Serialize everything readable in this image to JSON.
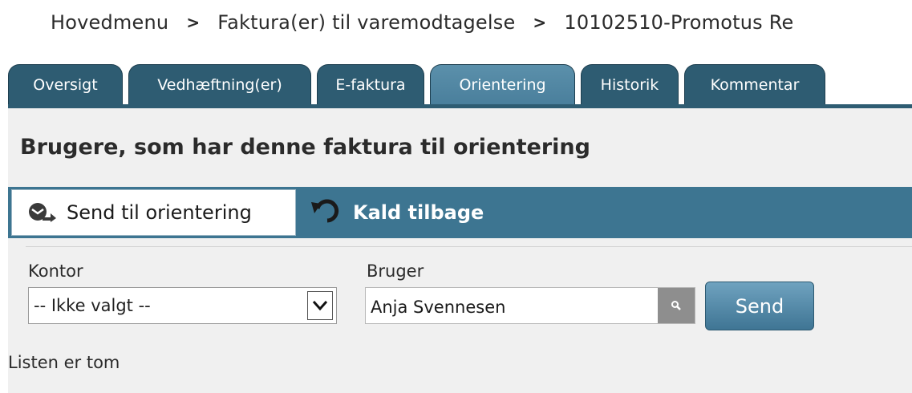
{
  "breadcrumb": {
    "items": [
      "Hovedmenu",
      "Faktura(er) til varemodtagelse",
      "10102510-Promotus Re"
    ],
    "separator": ">"
  },
  "tabs": [
    {
      "label": "Oversigt",
      "active": false
    },
    {
      "label": "Vedhæftning(er)",
      "active": false
    },
    {
      "label": "E-faktura",
      "active": false
    },
    {
      "label": "Orientering",
      "active": true
    },
    {
      "label": "Historik",
      "active": false
    },
    {
      "label": "Kommentar",
      "active": false
    }
  ],
  "section": {
    "title": "Brugere, som har denne faktura til orientering"
  },
  "toolbar": {
    "send_label": "Send til orientering",
    "send_icon": "send-orientation-icon",
    "recall_label": "Kald tilbage",
    "recall_icon": "undo-arrow-icon"
  },
  "form": {
    "office_label": "Kontor",
    "office_value": "-- Ikke valgt --",
    "user_label": "Bruger",
    "user_value": "Anja Svennesen",
    "lookup_icon": "search-icon",
    "send_button": "Send"
  },
  "list": {
    "empty_text": "Listen er tom"
  },
  "colors": {
    "tab_bg": "#2e5c72",
    "tab_active_bg": "#4a7f9c",
    "toolbar_bg": "#3d7591",
    "panel_bg": "#f0f0f0"
  }
}
